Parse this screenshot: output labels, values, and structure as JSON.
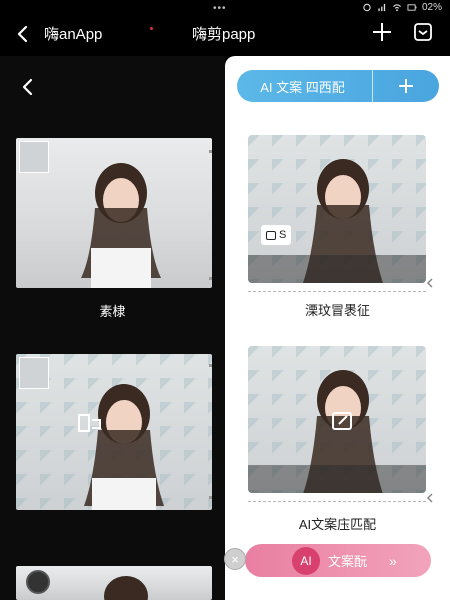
{
  "status": {
    "dots": "•••",
    "battery": "02%"
  },
  "header": {
    "left_app_name": "嗨anApp",
    "center_title": "嗨剪papp"
  },
  "left": {
    "cards": [
      {
        "caption": "素棣"
      },
      {
        "caption": ""
      },
      {
        "caption": ""
      }
    ]
  },
  "right": {
    "top_pill_label": "AI 文案 四西配",
    "cards": [
      {
        "badge_label": "S",
        "caption": "溧玟冒褁征"
      },
      {
        "caption": "AI文案庒匹配"
      }
    ],
    "bottom_pill": {
      "ai_badge": "AI",
      "label": "文案酛",
      "chevrons": "»"
    }
  },
  "colors": {
    "blue_pill": "#4aa5df",
    "pink_pill": "#ee8fae",
    "ai_circle": "#d8416d"
  },
  "icons": [
    "back-icon",
    "plus-icon",
    "inbox-icon",
    "wifi-icon",
    "signal-icon",
    "battery-icon",
    "crop-icon",
    "edit-icon",
    "chevron-left-icon",
    "close-icon",
    "double-chevron-right-icon"
  ]
}
